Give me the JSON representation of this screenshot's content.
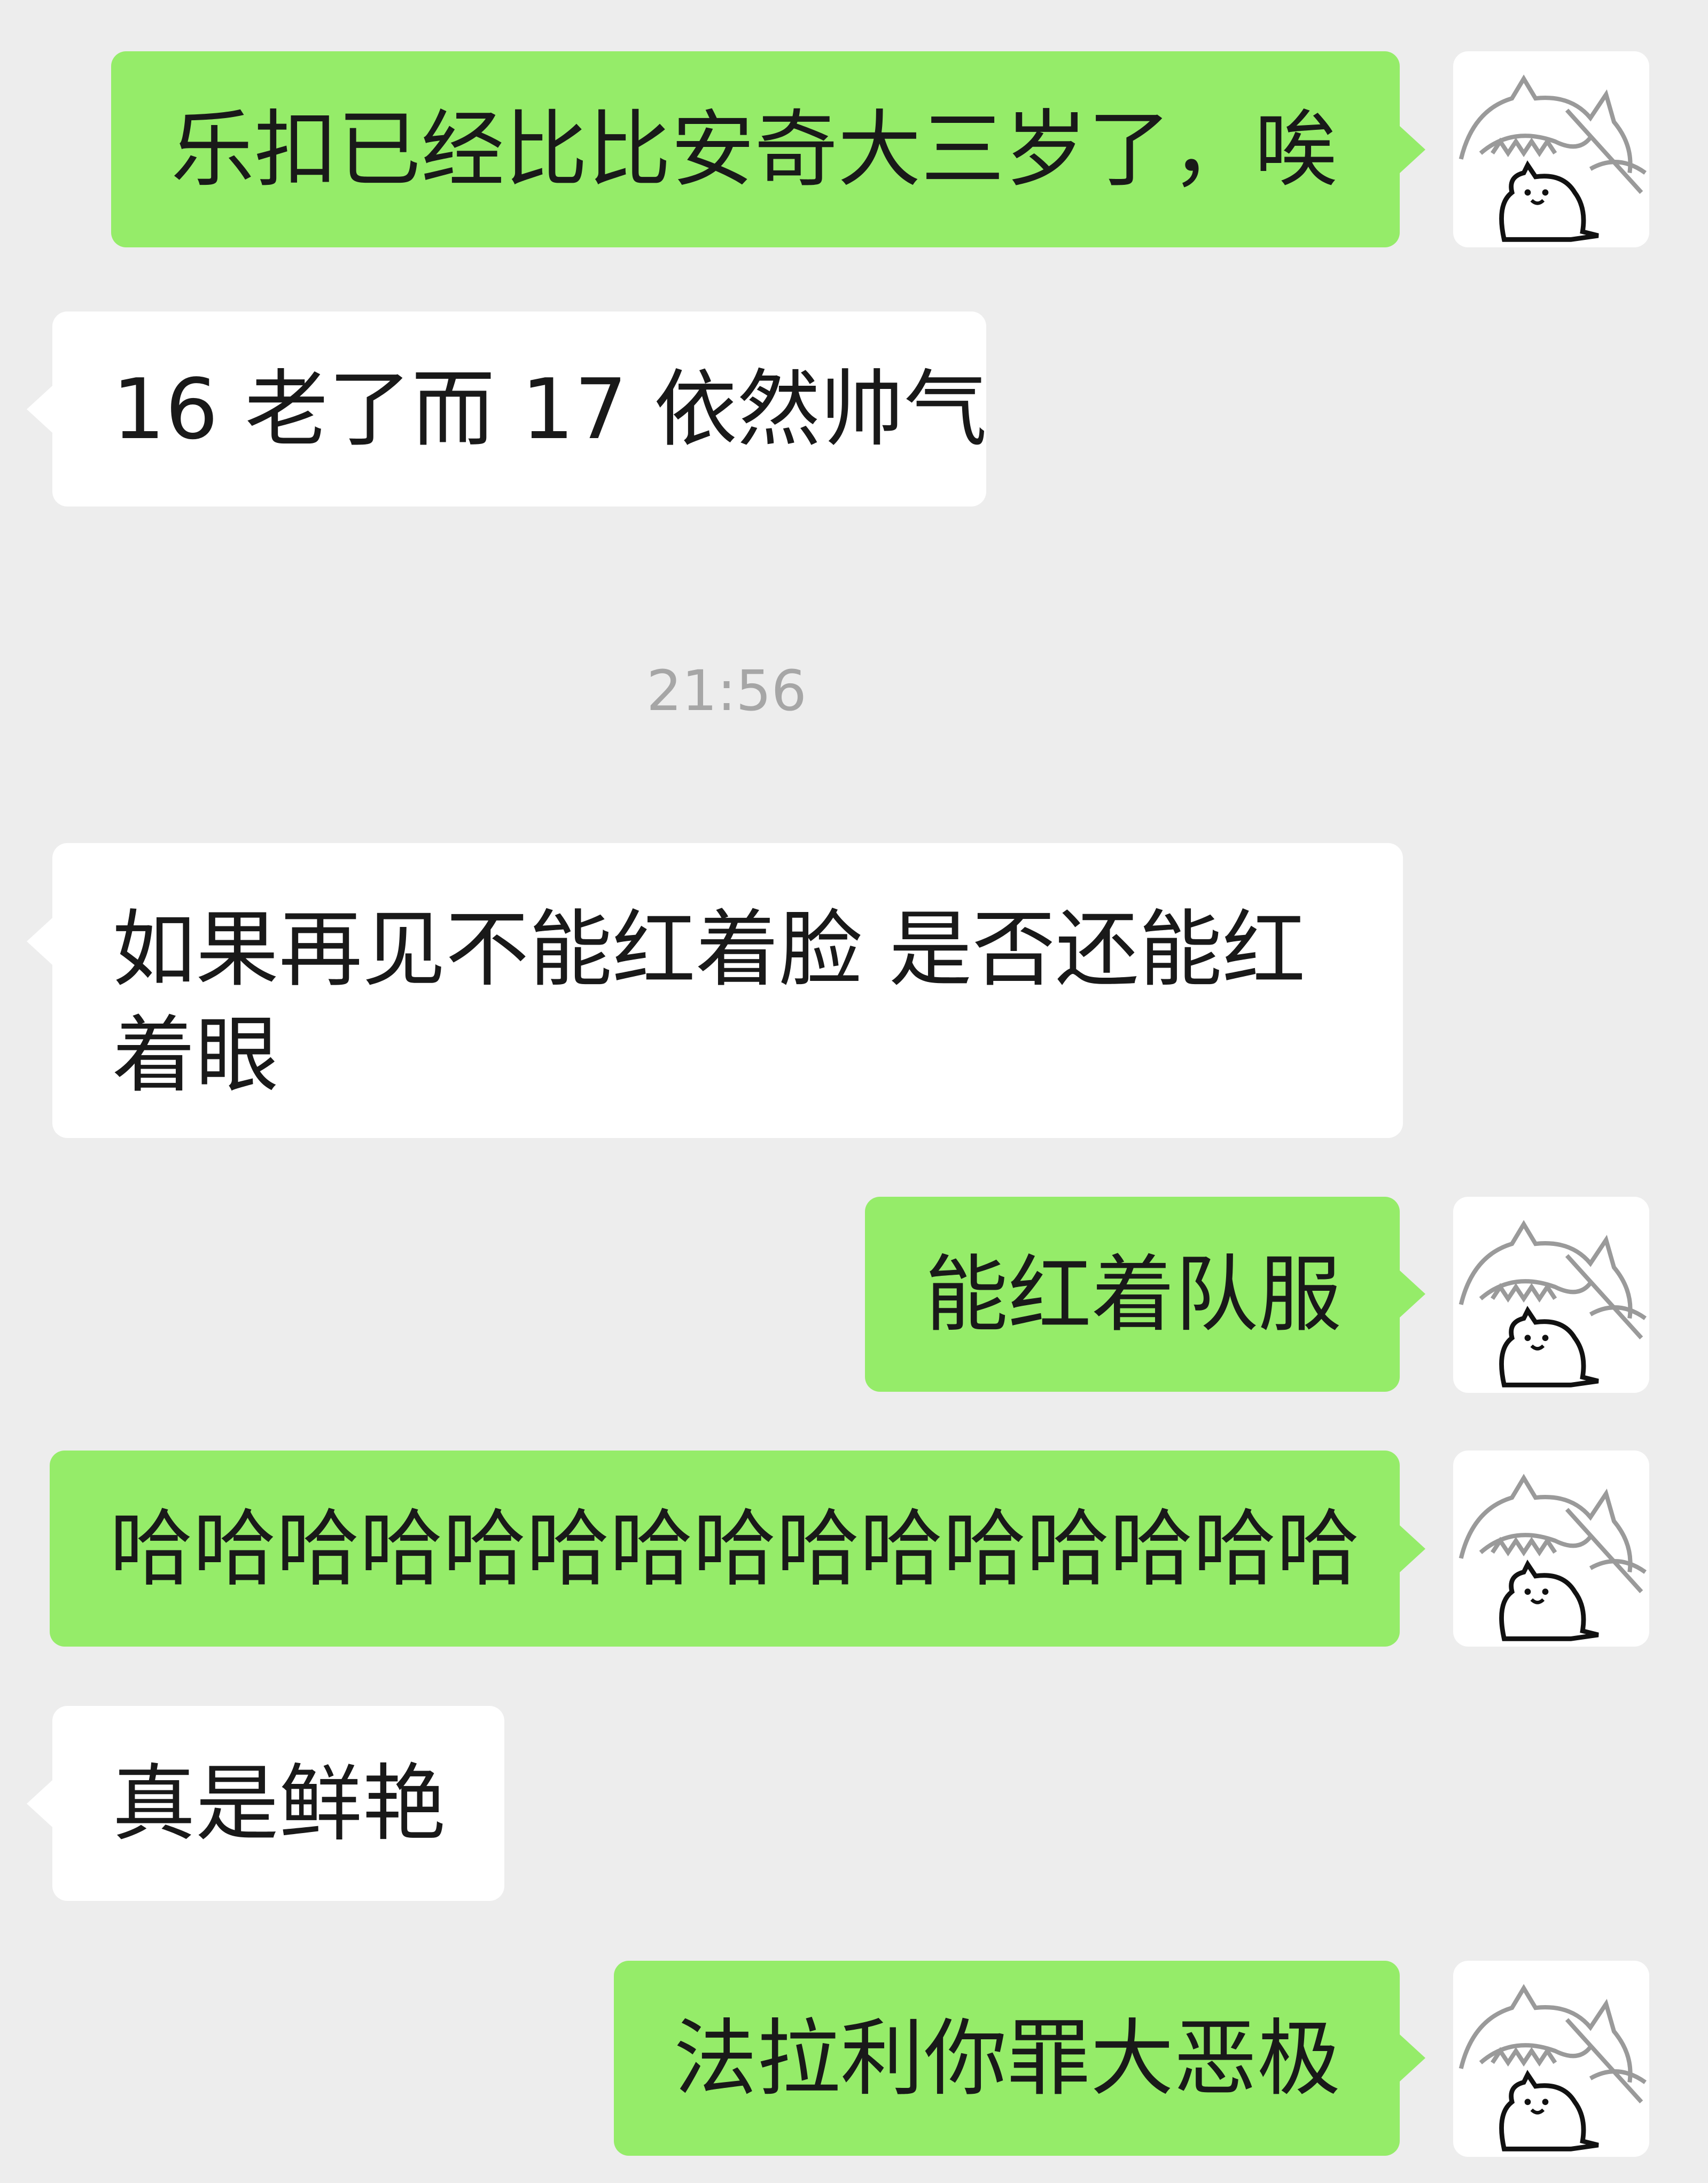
{
  "messages": [
    {
      "side": "self",
      "text": "乐扣已经比比安奇大三岁了，唉"
    },
    {
      "side": "other",
      "text": "16 老了而 17 依然帅气"
    },
    {
      "side": "other",
      "text": "如果再见不能红着脸 是否还能红着眼"
    },
    {
      "side": "self",
      "text": "能红着队服"
    },
    {
      "side": "self",
      "text": "哈哈哈哈哈哈哈哈哈哈哈哈哈哈哈"
    },
    {
      "side": "other",
      "text": "真是鲜艳"
    },
    {
      "side": "self",
      "text": "法拉利你罪大恶极"
    }
  ],
  "timestamp": "21:56",
  "avatar": {
    "icon": "cat-doodle-icon"
  },
  "colors": {
    "background": "#ededed",
    "self_bubble": "#95ec69",
    "other_bubble": "#ffffff",
    "text": "#191919",
    "timestamp": "#a6a6a6"
  }
}
